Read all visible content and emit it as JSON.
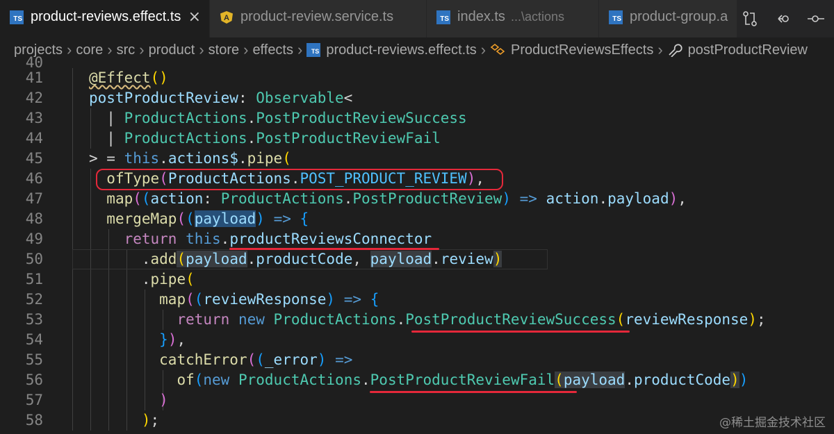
{
  "tabs": [
    {
      "title": "product-reviews.effect.ts",
      "icon": "ts-icon",
      "active": true,
      "close": "×"
    },
    {
      "title": "product-review.service.ts",
      "icon": "angular-icon",
      "active": false
    },
    {
      "title": "index.ts",
      "hint": "...\\actions",
      "icon": "ts-icon",
      "active": false
    },
    {
      "title": "product-group.a",
      "icon": "ts-icon",
      "active": false
    }
  ],
  "ts_badge": "TS",
  "breadcrumb": {
    "items": [
      "projects",
      "core",
      "src",
      "product",
      "store",
      "effects",
      "product-reviews.effect.ts",
      "ProductReviewsEffects",
      "postProductReview"
    ]
  },
  "editor": {
    "line_numbers": [
      "40",
      "41",
      "42",
      "43",
      "44",
      "45",
      "46",
      "47",
      "48",
      "49",
      "50",
      "51",
      "52",
      "53",
      "54",
      "55",
      "56",
      "57",
      "58"
    ]
  },
  "watermark": "@稀土掘金技术社区",
  "colors": {
    "highlight_box": "#e5283a",
    "keyword": "#569cd6",
    "type": "#4ec9b0",
    "variable": "#9cdcfe",
    "function": "#dcdcaa"
  }
}
